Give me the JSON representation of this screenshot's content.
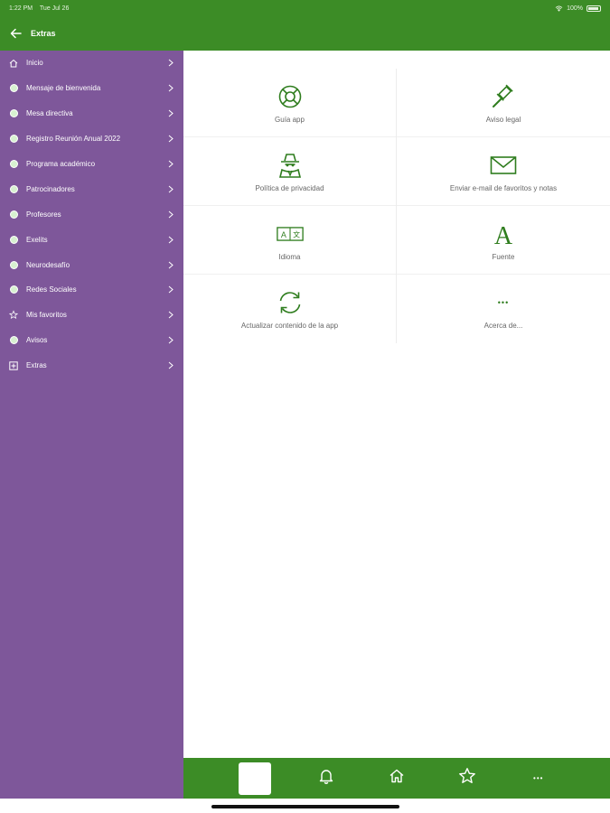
{
  "status_bar": {
    "time": "1:22 PM",
    "date": "Tue Jul 26",
    "battery": "100%"
  },
  "header": {
    "title": "Extras"
  },
  "sidebar": {
    "items": [
      {
        "label": "Inicio",
        "icon": "home-icon"
      },
      {
        "label": "Mensaje de bienvenida",
        "icon": "circle-icon"
      },
      {
        "label": "Mesa directiva",
        "icon": "circle-icon"
      },
      {
        "label": "Registro Reunión Anual 2022",
        "icon": "circle-icon"
      },
      {
        "label": "Programa académico",
        "icon": "circle-icon"
      },
      {
        "label": "Patrocinadores",
        "icon": "circle-icon"
      },
      {
        "label": "Profesores",
        "icon": "circle-icon"
      },
      {
        "label": "Exelits",
        "icon": "circle-icon"
      },
      {
        "label": "Neurodesafío",
        "icon": "circle-icon"
      },
      {
        "label": "Redes Sociales",
        "icon": "circle-icon"
      },
      {
        "label": "Mis favoritos",
        "icon": "star-icon"
      },
      {
        "label": "Avisos",
        "icon": "circle-icon"
      },
      {
        "label": "Extras",
        "icon": "grid-plus-icon"
      }
    ]
  },
  "extras": {
    "guia": "Guía app",
    "aviso": "Aviso legal",
    "politica": "Política de privacidad",
    "email": "Enviar e-mail de favoritos y notas",
    "idioma": "Idioma",
    "idioma_glyphs": {
      "a": "A",
      "b": "文"
    },
    "fuente": "Fuente",
    "fuente_glyph": "A",
    "actualizar": "Actualizar contenido de la app",
    "acerca": "Acerca de...",
    "acerca_glyph": "•••"
  },
  "bottom_nav": {
    "more_glyph": "•••"
  },
  "colors": {
    "brand_green": "#3c8c26",
    "sidebar_purple": "#7e579a",
    "icon_green": "#2f7d1e"
  }
}
